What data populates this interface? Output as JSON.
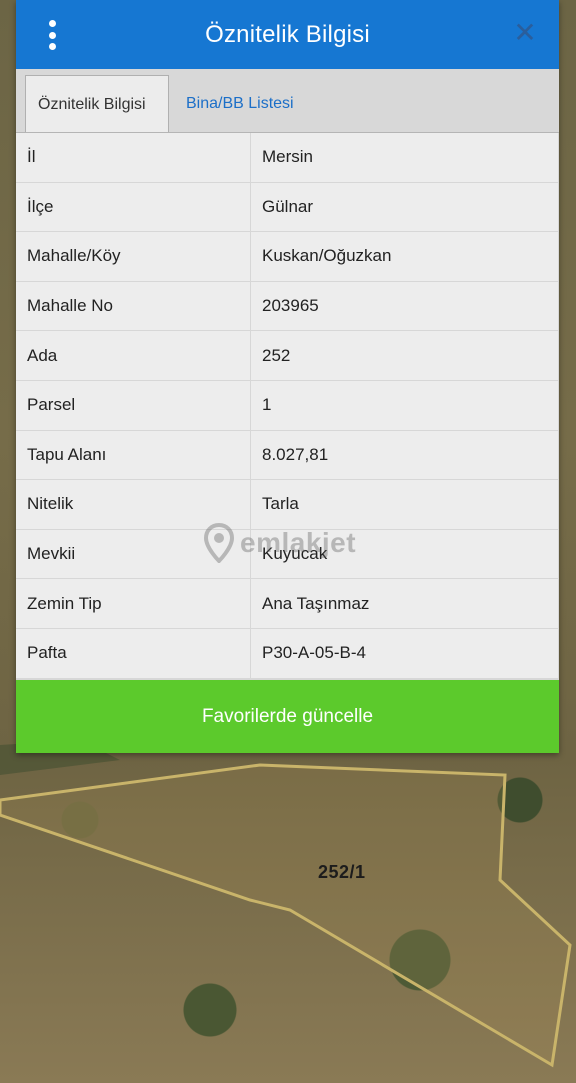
{
  "dialog": {
    "title": "Öznitelik Bilgisi"
  },
  "tabs": [
    {
      "label": "Öznitelik Bilgisi",
      "active": true
    },
    {
      "label": "Bina/BB Listesi",
      "active": false
    }
  ],
  "attributes": [
    {
      "key": "İl",
      "value": "Mersin"
    },
    {
      "key": "İlçe",
      "value": "Gülnar"
    },
    {
      "key": "Mahalle/Köy",
      "value": "Kuskan/Oğuzkan"
    },
    {
      "key": "Mahalle No",
      "value": "203965"
    },
    {
      "key": "Ada",
      "value": "252"
    },
    {
      "key": "Parsel",
      "value": "1"
    },
    {
      "key": "Tapu Alanı",
      "value": "8.027,81"
    },
    {
      "key": "Nitelik",
      "value": "Tarla"
    },
    {
      "key": "Mevkii",
      "value": "Kuyucak"
    },
    {
      "key": "Zemin Tip",
      "value": "Ana Taşınmaz"
    },
    {
      "key": "Pafta",
      "value": "P30-A-05-B-4"
    }
  ],
  "actions": {
    "save_label": "Favorilerde güncelle"
  },
  "map": {
    "parcel_label": "252/1"
  },
  "watermark": {
    "text": "emlakjet"
  },
  "icons": {
    "menu": "vertical-dots-icon",
    "close": "close-icon",
    "watermark": "location-pin-icon"
  },
  "colors": {
    "header": "#1677d2",
    "save_button": "#5cca2c",
    "tab_link": "#1c6fc8",
    "parcel_outline": "#c9b46a"
  }
}
